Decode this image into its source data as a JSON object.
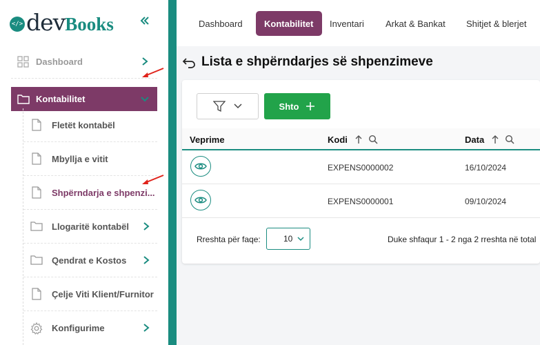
{
  "app": {
    "logo_dev": "dev",
    "logo_books": "Books",
    "logo_badge": "</>"
  },
  "sidebar": {
    "items": [
      {
        "label": "Dashboard",
        "icon": "grid-icon"
      },
      {
        "label": "Kontabilitet",
        "icon": "folder-icon"
      }
    ],
    "subitems": [
      {
        "label": "Fletët kontabël",
        "icon": "document-icon"
      },
      {
        "label": "Mbyllja e vitit",
        "icon": "document-icon"
      },
      {
        "label": "Shpërndarja e shpenzi...",
        "icon": "document-icon"
      },
      {
        "label": "Llogaritë kontabël",
        "icon": "folder-icon"
      },
      {
        "label": "Qendrat e Kostos",
        "icon": "folder-icon"
      },
      {
        "label": "Çelje Viti Klient/Furnitor",
        "icon": "document-icon"
      },
      {
        "label": "Konfigurime",
        "icon": "gear-icon"
      }
    ]
  },
  "topnav": {
    "tabs": [
      {
        "label": "Dashboard"
      },
      {
        "label": "Kontabilitet"
      },
      {
        "label": "Inventari"
      },
      {
        "label": "Arkat & Bankat"
      },
      {
        "label": "Shitjet & blerjet"
      }
    ]
  },
  "page": {
    "title": "Lista e shpërndarjes së shpenzimeve"
  },
  "toolbar": {
    "add_label": "Shto"
  },
  "table": {
    "columns": [
      "Veprime",
      "Kodi",
      "Data"
    ],
    "rows": [
      {
        "code": "EXPENS0000002",
        "date": "16/10/2024"
      },
      {
        "code": "EXPENS0000001",
        "date": "09/10/2024"
      }
    ]
  },
  "pager": {
    "rows_label": "Rreshta për faqe:",
    "page_size": "10",
    "info": "Duke shfaqur 1 - 2 nga 2 rreshta në total"
  },
  "colors": {
    "brand_teal": "#1a8c80",
    "brand_purple": "#7d3a67",
    "add_green": "#22a34a",
    "annotation_red": "#e0231b"
  }
}
